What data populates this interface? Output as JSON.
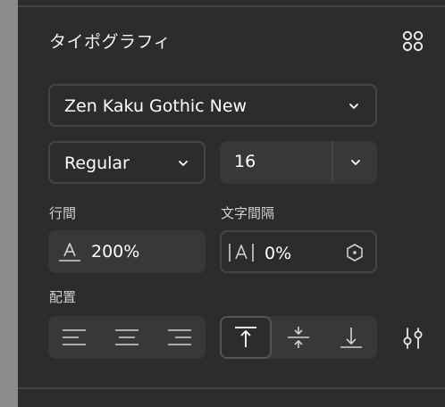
{
  "section": {
    "title": "タイポグラフィ"
  },
  "font_family": {
    "value": "Zen Kaku Gothic New"
  },
  "font_weight": {
    "value": "Regular"
  },
  "font_size": {
    "value": "16"
  },
  "line_height": {
    "label": "行間",
    "value": "200%"
  },
  "letter_spacing": {
    "label": "文字間隔",
    "value": "0%"
  },
  "alignment": {
    "label": "配置",
    "horizontal": [
      "left",
      "center",
      "right"
    ],
    "vertical": [
      "top",
      "middle",
      "bottom"
    ],
    "vertical_selected": "top"
  },
  "colors": {
    "panel_bg": "#2c2c2c",
    "field_bg": "#383838",
    "border": "#464646",
    "text": "#ffffff"
  },
  "icons": [
    "styles-grid-icon",
    "chevron-down-icon",
    "line-height-icon",
    "letter-spacing-icon",
    "hexagon-icon",
    "align-left-icon",
    "align-center-icon",
    "align-right-icon",
    "align-top-icon",
    "align-middle-icon",
    "align-bottom-icon",
    "sliders-icon"
  ]
}
